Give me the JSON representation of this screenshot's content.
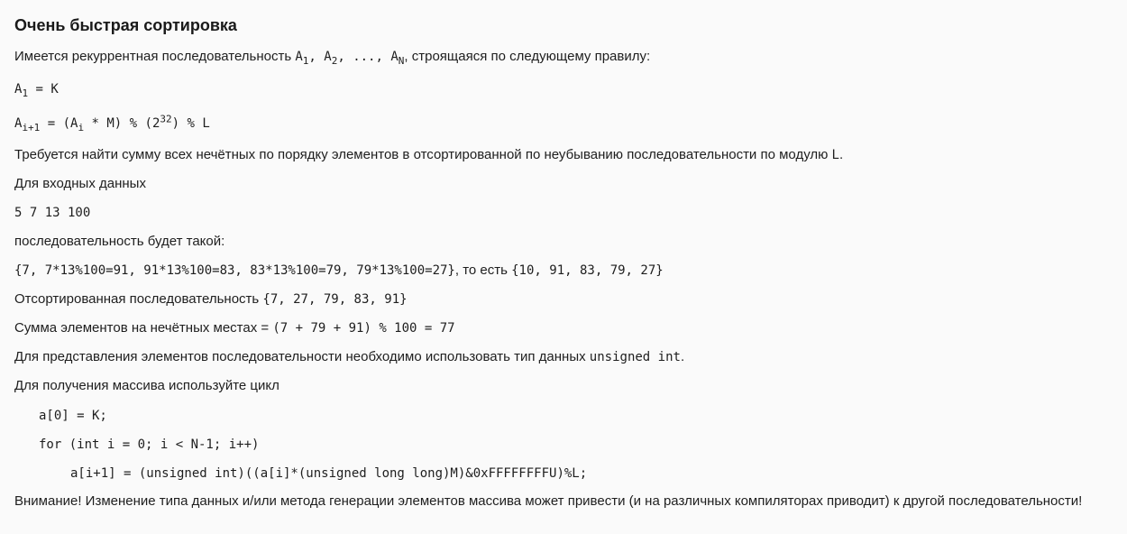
{
  "title": "Очень быстрая сортировка",
  "intro": {
    "text": "Имеется рекуррентная последовательность",
    "seq_a": "A",
    "sub1": "1",
    "sep1": ", ",
    "sub2": "2",
    "ellipsis": ", ..., ",
    "subN": "N",
    "rule_text": ", строящаяся по следующему правилу:"
  },
  "formula1": {
    "a": "A",
    "sub": "1",
    "rhs": " = K"
  },
  "formula2": {
    "a": "A",
    "sub": "i+1",
    "mid1": " = (A",
    "sub_i": "i",
    "mid2": " * M) % (2",
    "sup": "32",
    "tail": ") % L"
  },
  "task": {
    "text": "Требуется найти сумму всех нечётных по порядку элементов в отсортированной по неубыванию последовательности по модулю",
    "mod": "L",
    "end": "."
  },
  "input_label": "Для входных данных",
  "input_values": "5 7 13 100",
  "sequence_label": "последовательность будет такой:",
  "sequence": {
    "calc": "{7, 7*13%100=91, 91*13%100=83, 83*13%100=79, 79*13%100=27}",
    "that_is": ", то есть ",
    "result": "{10, 91, 83, 79, 27}"
  },
  "sorted": {
    "label": "Отсортированная последовательность ",
    "values": "{7, 27, 79, 83, 91}"
  },
  "sum": {
    "label": "Сумма элементов на нечётных местах = ",
    "expr": "(7 + 79 + 91) % 100 = 77"
  },
  "type_note": {
    "text": "Для представления элементов последовательности необходимо использовать тип данных ",
    "type": "unsigned int",
    "end": "."
  },
  "loop_label": "Для получения массива используйте цикл",
  "code": [
    "a[0] = K;",
    "for (int i = 0; i < N-1; i++)",
    "a[i+1] = (unsigned int)((a[i]*(unsigned long long)M)&0xFFFFFFFFU)%L;"
  ],
  "warning": "Внимание! Изменение типа данных и/или метода генерации элементов массива может привести (и на различных компиляторах приводит) к другой последовательности!"
}
